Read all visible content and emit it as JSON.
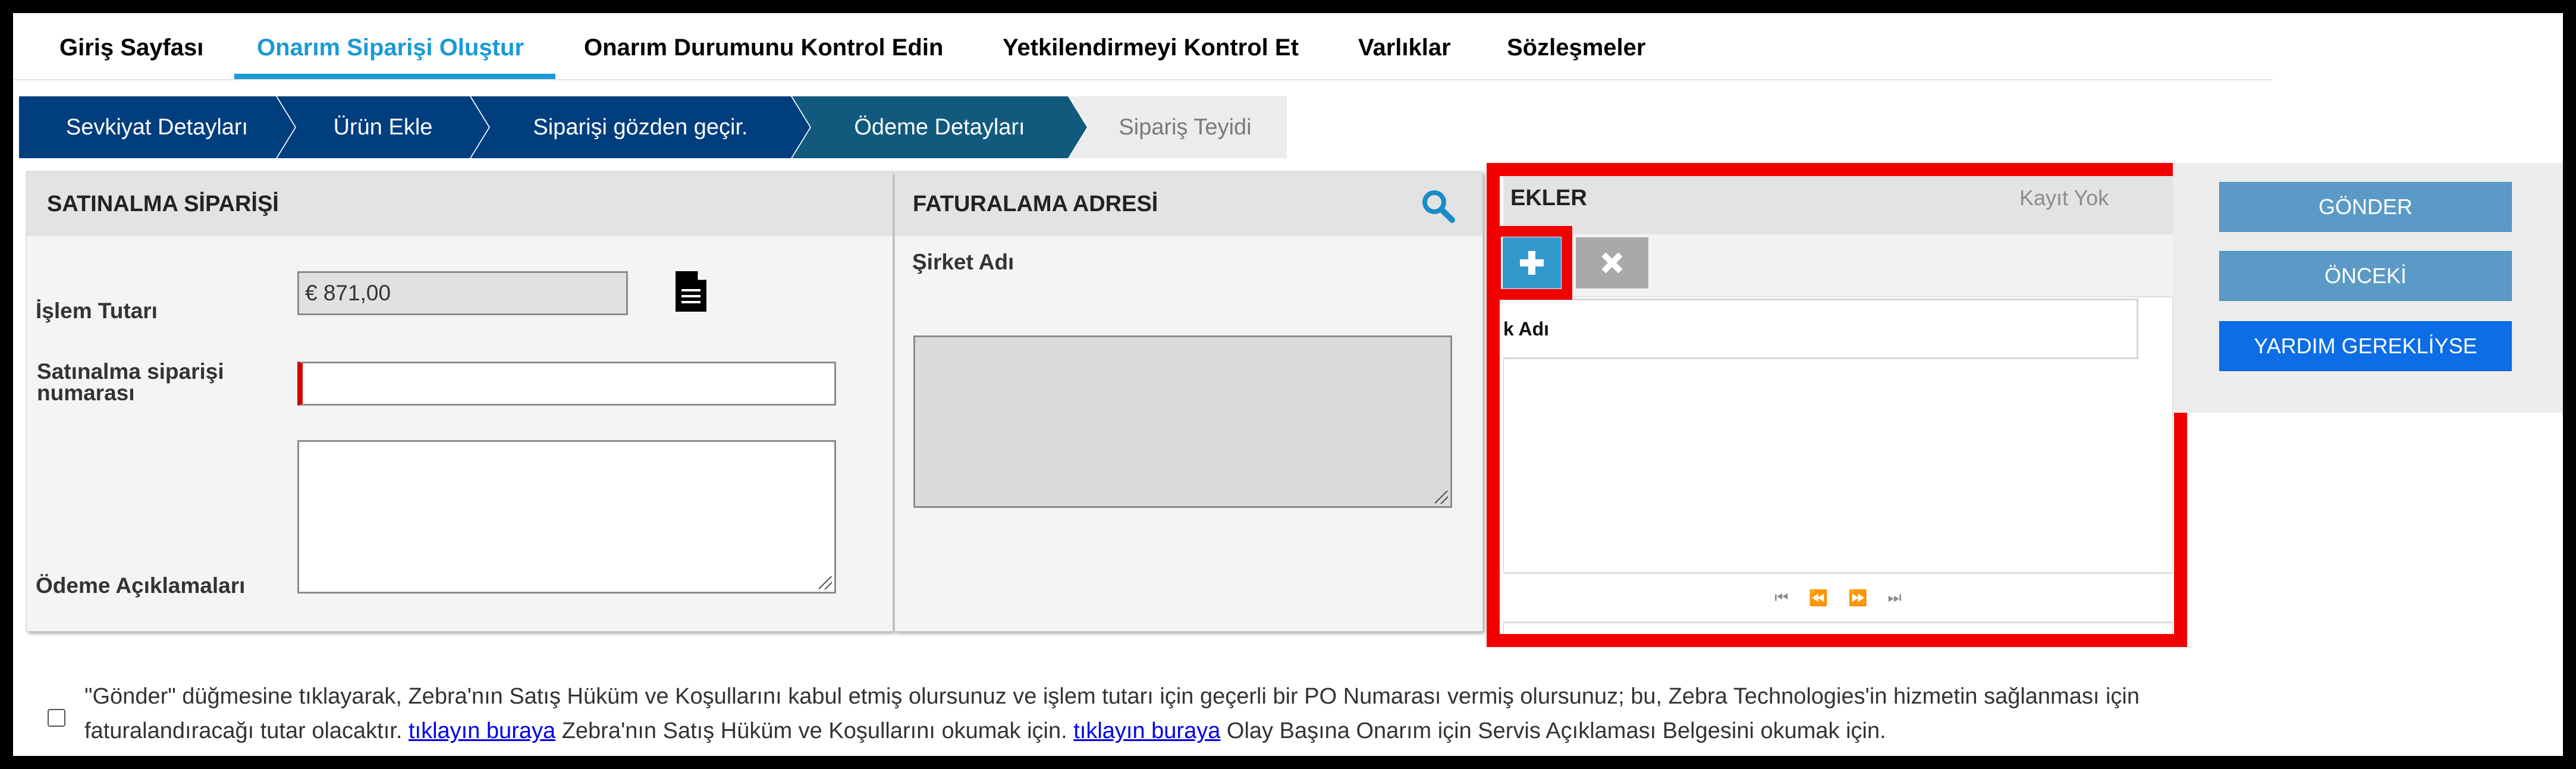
{
  "nav": {
    "items": [
      {
        "label": "Giriş Sayfası"
      },
      {
        "label": "Onarım Siparişi Oluştur"
      },
      {
        "label": "Onarım Durumunu Kontrol Edin"
      },
      {
        "label": "Yetkilendirmeyi Kontrol Et"
      },
      {
        "label": "Varlıklar"
      },
      {
        "label": "Sözleşmeler"
      }
    ],
    "active": "Onarım Siparişi Oluştur"
  },
  "steps": [
    {
      "label": "Sevkiyat Detayları",
      "state": "done"
    },
    {
      "label": "Ürün Ekle",
      "state": "done"
    },
    {
      "label": "Siparişi gözden geçir.",
      "state": "done"
    },
    {
      "label": "Ödeme Detayları",
      "state": "current"
    },
    {
      "label": "Sipariş Teyidi",
      "state": "pending"
    }
  ],
  "purchase_order": {
    "title": "SATINALMA SİPARİŞİ",
    "amount_label": "İşlem Tutarı",
    "amount_value": "€ 871,00",
    "po_label_1": "Satınalma siparişi",
    "po_label_2": "numarası",
    "po_value": "",
    "payment_notes_label": "Ödeme Açıklamaları"
  },
  "billing": {
    "title": "FATURALAMA ADRESİ",
    "company_label": "Şirket Adı"
  },
  "attachments": {
    "title": "EKLER",
    "status": "Kayıt Yok",
    "column_header": "k Adı"
  },
  "actions": {
    "send": "GÖNDER",
    "previous": "ÖNCEKİ",
    "help": "YARDIM GEREKLİYSE"
  },
  "terms": {
    "part1": "\"Gönder\" düğmesine tıklayarak, Zebra'nın Satış Hüküm ve Koşullarını kabul etmiş olursunuz ve işlem tutarı için geçerli bir PO Numarası vermiş olursunuz; bu, Zebra Technologies'in hizmetin sağlanması için faturalandıracağı tutar olacaktır.",
    "link1": "tıklayın buraya",
    "part2": "Zebra'nın Satış Hüküm ve Koşullarını okumak için.",
    "link2": "tıklayın buraya",
    "part3": "Olay Başına Onarım için Servis Açıklaması Belgesini okumak için."
  },
  "colors": {
    "accent": "#1a9ad6",
    "step_done": "#003e7e",
    "step_current": "#115a7e",
    "highlight": "#f20000"
  }
}
